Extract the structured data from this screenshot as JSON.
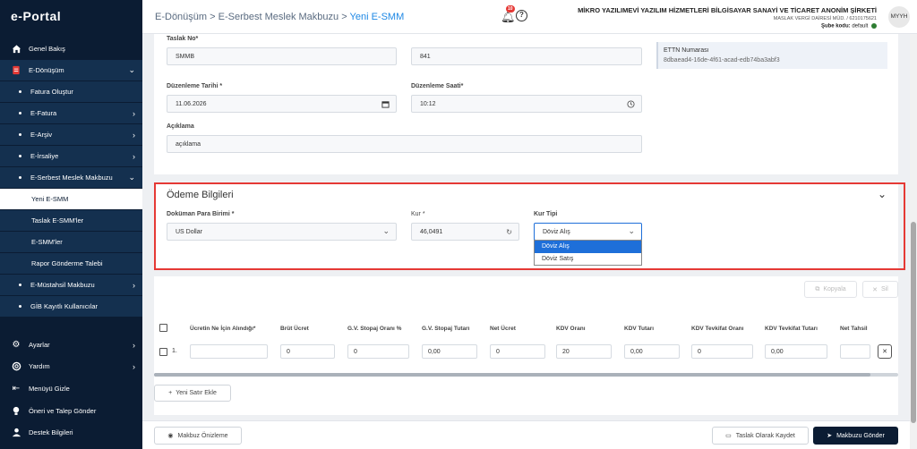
{
  "app": {
    "logo": "e-Portal"
  },
  "sidebar": {
    "items": [
      {
        "label": "Genel Bakış",
        "icon": "home-icon"
      },
      {
        "label": "E-Dönüşüm",
        "icon": "document-icon"
      },
      {
        "label": "Fatura Oluştur"
      },
      {
        "label": "E-Fatura"
      },
      {
        "label": "E-Arşiv"
      },
      {
        "label": "E-İrsaliye"
      },
      {
        "label": "E-Serbest Meslek Makbuzu"
      },
      {
        "label": "Yeni E-SMM"
      },
      {
        "label": "Taslak E-SMM'ler"
      },
      {
        "label": "E-SMM'ler"
      },
      {
        "label": "Rapor Gönderme Talebi"
      },
      {
        "label": "E-Müstahsil Makbuzu"
      },
      {
        "label": "GİB Kayıtlı Kullanıcılar"
      },
      {
        "label": "Ayarlar",
        "icon": "gear-icon"
      },
      {
        "label": "Yardım",
        "icon": "lifebuoy-icon"
      },
      {
        "label": "Menüyü Gizle",
        "icon": "collapse-menu-icon"
      },
      {
        "label": "Öneri ve Talep Gönder",
        "icon": "bulb-icon"
      },
      {
        "label": "Destek Bilgileri",
        "icon": "support-icon"
      }
    ]
  },
  "header": {
    "breadcrumb": {
      "part1": "E-Dönüşüm",
      "sep": ">",
      "part2": "E-Serbest Meslek Makbuzu",
      "current": "Yeni E-SMM"
    },
    "notif_count": "10",
    "company": "MİKRO YAZILIMEVİ YAZILIM HİZMETLERİ BİLGİSAYAR SANAYİ VE TİCARET ANONİM ŞİRKETİ",
    "tax_office": "MASLAK VERGİ DAİRESİ MÜD. / 6210175621",
    "branch_label": "Şube kodu:",
    "branch_value": "default",
    "avatar": "MYYH"
  },
  "form": {
    "taslak_label": "Taslak No*",
    "taslak_prefix": "SMMB",
    "taslak_number": "841",
    "ettn_label": "ETTN Numarası",
    "ettn_value": "8dbaead4-16de-4f61-acad-edb74ba3abf3",
    "date_label": "Düzenleme Tarihi *",
    "date_value": "11.06.2026",
    "time_label": "Düzenleme Saati*",
    "time_value": "10:12",
    "desc_label": "Açıklama",
    "desc_value": "açıklama"
  },
  "payment": {
    "title": "Ödeme Bilgileri",
    "currency_label": "Doküman Para Birimi *",
    "currency_value": "US Dollar",
    "rate_label": "Kur *",
    "rate_value": "46,0491",
    "rate_type_label": "Kur Tipi",
    "rate_type_value": "Döviz Alış",
    "rate_type_options": [
      "Döviz Alış",
      "Döviz Satış"
    ]
  },
  "table": {
    "copy_button": "Kopyala",
    "delete_button": "Sil",
    "headers": [
      "Ücretin Ne İçin Alındığı*",
      "Brüt Ücret",
      "G.V. Stopaj Oranı %",
      "G.V. Stopaj Tutarı",
      "Net Ücret",
      "KDV Oranı",
      "KDV Tutarı",
      "KDV Tevkifat Oranı",
      "KDV Tevkifat Tutarı",
      "Net Tahsil"
    ],
    "row": {
      "index": "1.",
      "cells": [
        "",
        "0",
        "0",
        "0,00",
        "0",
        "20",
        "0,00",
        "0",
        "0,00",
        ""
      ]
    },
    "add_row": "Yeni Satır Ekle"
  },
  "footer": {
    "preview": "Makbuz Önizleme",
    "save_draft": "Taslak Olarak Kaydet",
    "send": "Makbuzu Gönder"
  },
  "colors": {
    "sidebar": "#0b1c33",
    "accent": "#1e88e5",
    "highlight": "#e53935",
    "selected_option": "#1e6fd9"
  }
}
